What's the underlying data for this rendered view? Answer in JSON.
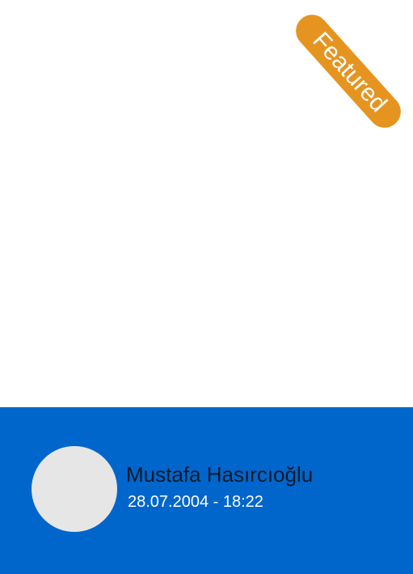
{
  "badge": {
    "label": "Featured",
    "color": "#e69420"
  },
  "footer": {
    "background_color": "#0066cc",
    "author_name": "Mustafa Hasırcıoğlu",
    "author_name_color": "#0d1a2a",
    "date": "28.07.2004 - 18:22"
  }
}
